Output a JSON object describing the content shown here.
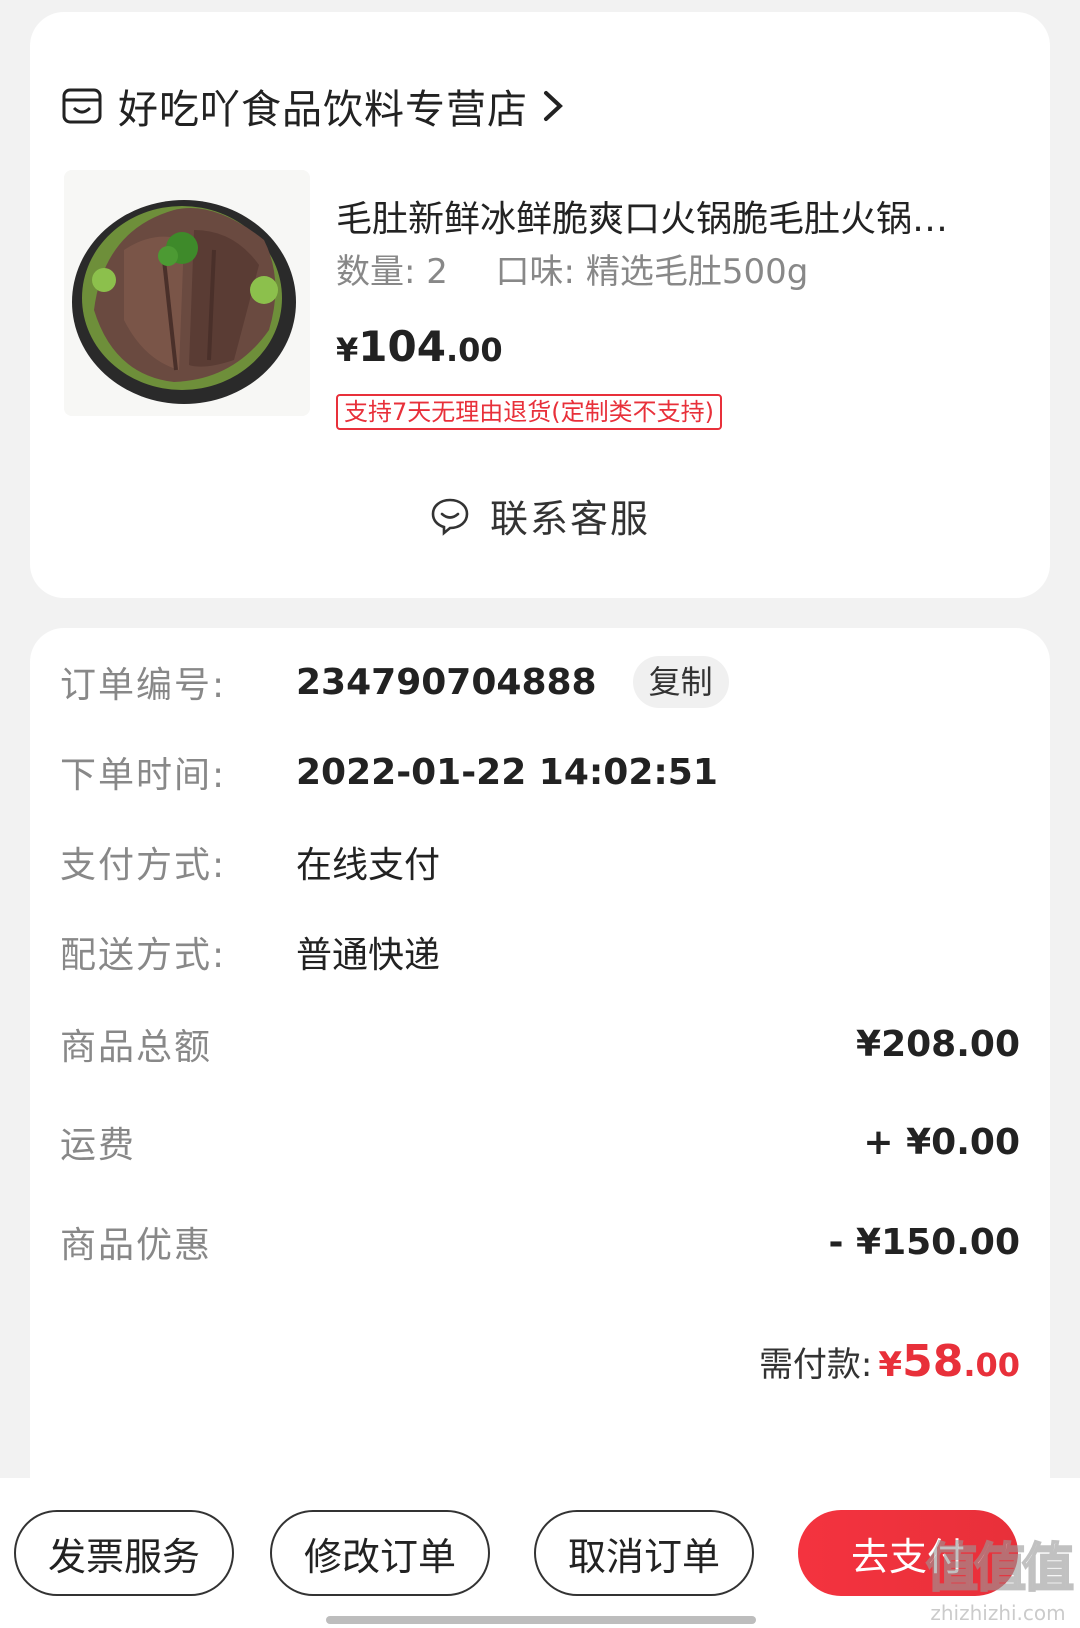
{
  "shop": {
    "name": "好吃吖食品饮料专营店"
  },
  "product": {
    "title": "毛肚新鲜冰鲜脆爽口火锅脆毛肚火锅…",
    "quantity_label": "数量:",
    "quantity": "2",
    "flavor_label": "口味:",
    "flavor": "精选毛肚500g",
    "price_currency": "¥",
    "price_int": "104",
    "price_dec": ".00",
    "return_policy": "支持7天无理由退货(定制类不支持)"
  },
  "contact": {
    "label": "联系客服"
  },
  "order": {
    "number_label": "订单编号:",
    "number": "234790704888",
    "copy_label": "复制",
    "time_label": "下单时间:",
    "time": "2022-01-22 14:02:51",
    "payment_label": "支付方式:",
    "payment": "在线支付",
    "delivery_label": "配送方式:",
    "delivery": "普通快递",
    "subtotal_label": "商品总额",
    "subtotal": "¥208.00",
    "shipping_label": "运费",
    "shipping": "+ ¥0.00",
    "discount_label": "商品优惠",
    "discount": "- ¥150.00",
    "due_label": "需付款:",
    "due_currency": "¥",
    "due_int": "58",
    "due_dec": ".00"
  },
  "actions": {
    "invoice": "发票服务",
    "modify": "修改订单",
    "cancel": "取消订单",
    "pay": "去支付"
  },
  "watermark": {
    "logo": "值值值",
    "url": "zhizhizhi.com"
  },
  "colors": {
    "accent": "#e8303a",
    "label_gray": "#888888"
  }
}
